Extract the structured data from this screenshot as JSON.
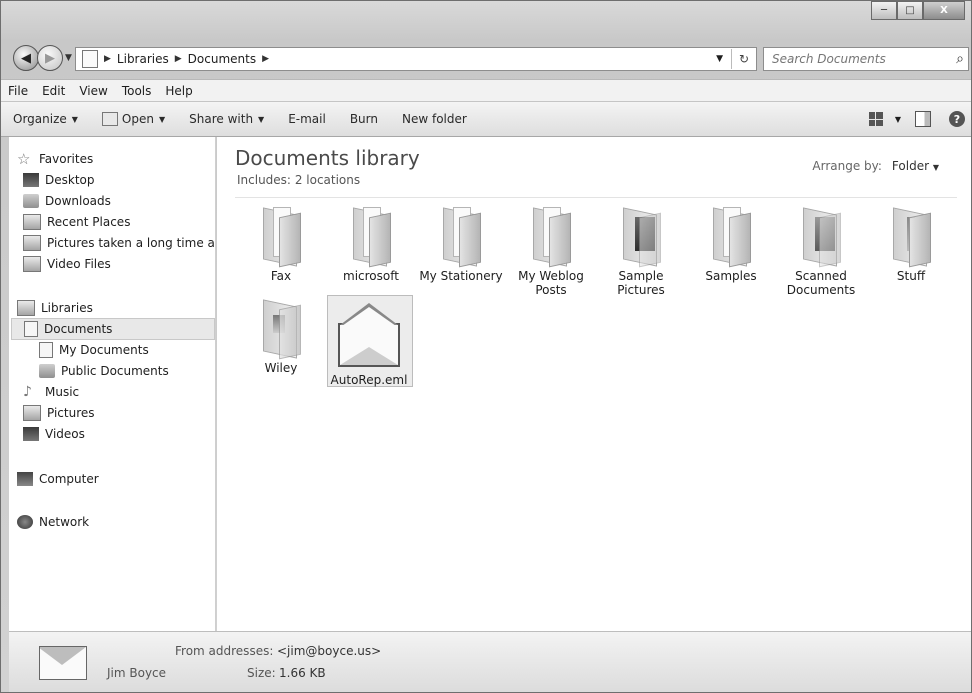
{
  "address": {
    "crumbs": [
      "Libraries",
      "Documents"
    ],
    "search_placeholder": "Search Documents"
  },
  "caption": {
    "minimize": "─",
    "maximize": "□",
    "close": "X"
  },
  "menu": [
    "File",
    "Edit",
    "View",
    "Tools",
    "Help"
  ],
  "toolbar": {
    "organize": "Organize",
    "open": "Open",
    "share_with": "Share with",
    "email": "E-mail",
    "burn": "Burn",
    "new_folder": "New folder"
  },
  "nav": {
    "favorites": "Favorites",
    "desktop": "Desktop",
    "downloads": "Downloads",
    "recent_places": "Recent Places",
    "pictures_long": "Pictures taken a long time ago",
    "video_files": "Video Files",
    "libraries": "Libraries",
    "documents": "Documents",
    "my_documents": "My Documents",
    "public_documents": "Public Documents",
    "music": "Music",
    "pictures": "Pictures",
    "videos": "Videos",
    "computer": "Computer",
    "network": "Network"
  },
  "library": {
    "title": "Documents library",
    "includes": "Includes:",
    "locations": "2 locations",
    "arrange_label": "Arrange by:",
    "arrange_value": "Folder"
  },
  "items": [
    {
      "label": "Fax",
      "icon": "folder"
    },
    {
      "label": "microsoft",
      "icon": "folder"
    },
    {
      "label": "My Stationery",
      "icon": "folder"
    },
    {
      "label": "My Weblog Posts",
      "icon": "folder"
    },
    {
      "label": "Sample Pictures",
      "icon": "folder-picture"
    },
    {
      "label": "Samples",
      "icon": "folder"
    },
    {
      "label": "Scanned Documents",
      "icon": "folder-picture"
    },
    {
      "label": "Stuff",
      "icon": "folder"
    },
    {
      "label": "Wiley",
      "icon": "folder-document"
    },
    {
      "label": "AutoRep.eml",
      "icon": "email-file",
      "selected": true
    }
  ],
  "details": {
    "name": "Jim Boyce",
    "from_label": "From addresses:",
    "from_value": "<jim@boyce.us>",
    "size_label": "Size:",
    "size_value": "1.66 KB"
  }
}
